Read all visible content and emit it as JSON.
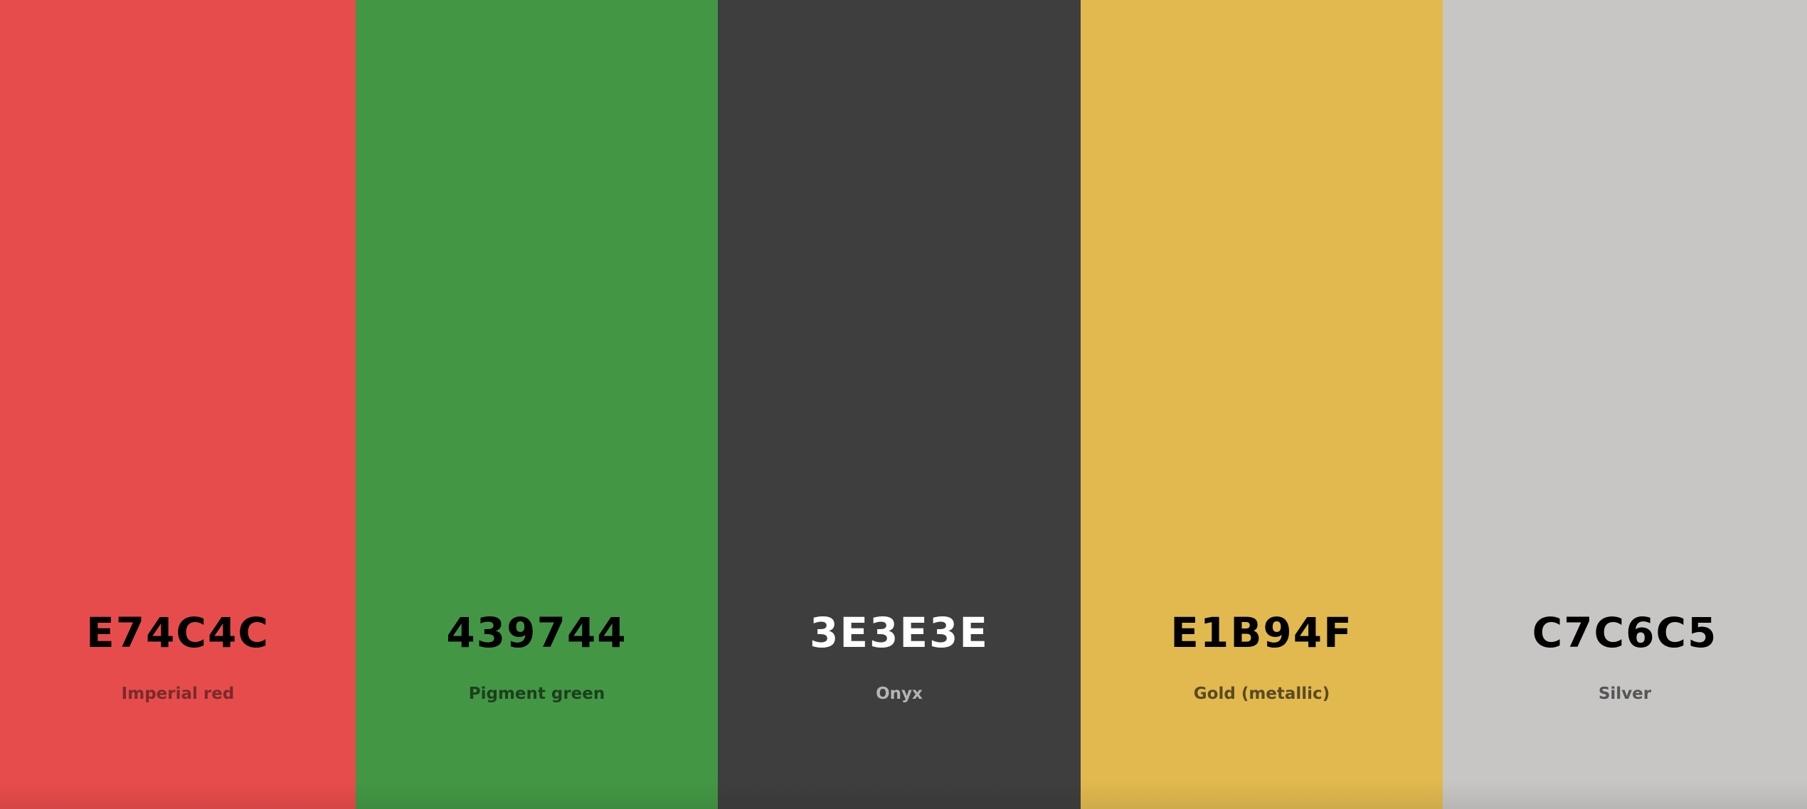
{
  "palette": {
    "swatches": [
      {
        "hex": "E74C4C",
        "name": "Imperial red",
        "color": "#E74C4C",
        "hex_text_color": "#000000",
        "name_text_color": "#7a2a2a"
      },
      {
        "hex": "439744",
        "name": "Pigment green",
        "color": "#439744",
        "hex_text_color": "#000000",
        "name_text_color": "#1d3f1e"
      },
      {
        "hex": "3E3E3E",
        "name": "Onyx",
        "color": "#3E3E3E",
        "hex_text_color": "#FFFFFF",
        "name_text_color": "#b5b5b5"
      },
      {
        "hex": "E1B94F",
        "name": "Gold (metallic)",
        "color": "#E1B94F",
        "hex_text_color": "#000000",
        "name_text_color": "#5a4a22"
      },
      {
        "hex": "C7C6C5",
        "name": "Silver",
        "color": "#C7C6C5",
        "hex_text_color": "#000000",
        "name_text_color": "#555555"
      }
    ]
  }
}
